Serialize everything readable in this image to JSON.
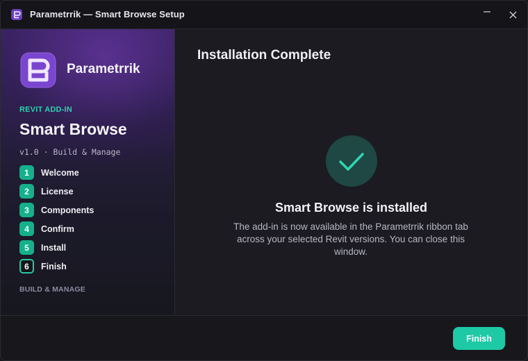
{
  "window": {
    "title": "Parametrrik — Smart Browse Setup",
    "minimize_icon": "minimize-icon",
    "close_icon": "close-icon"
  },
  "sidebar": {
    "brand": "Parametrrik",
    "eyebrow": "REVIT ADD-IN",
    "product": "Smart Browse",
    "version": "v1.0 · Build & Manage",
    "steps": [
      {
        "number": "1",
        "label": "Welcome",
        "state": "done"
      },
      {
        "number": "2",
        "label": "License",
        "state": "done"
      },
      {
        "number": "3",
        "label": "Components",
        "state": "done"
      },
      {
        "number": "4",
        "label": "Confirm",
        "state": "done"
      },
      {
        "number": "5",
        "label": "Install",
        "state": "done"
      },
      {
        "number": "6",
        "label": "Finish",
        "state": "current"
      }
    ],
    "tagline": "BUILD & MANAGE"
  },
  "main": {
    "heading": "Installation Complete",
    "status_icon": "checkmark-icon",
    "status_title": "Smart Browse is installed",
    "status_body": "The add-in is now available in the Parametrrik ribbon tab across your selected Revit versions. You can close this window."
  },
  "footer": {
    "finish_label": "Finish"
  },
  "colors": {
    "accent": "#1ec9a6",
    "step_done": "#15b08c",
    "brand_purple": "#7b4fd0"
  }
}
